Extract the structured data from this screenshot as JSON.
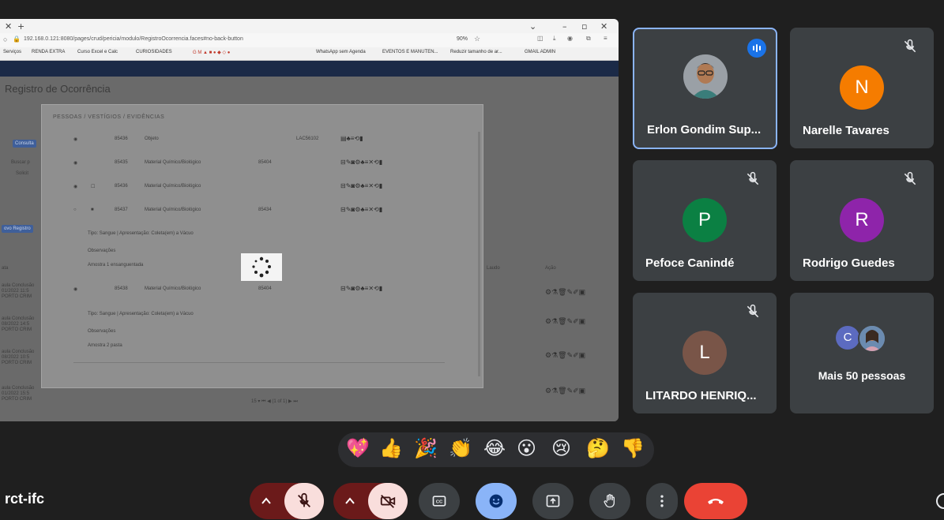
{
  "meeting": {
    "code": "rct-ifc"
  },
  "browser": {
    "url": "192.168.0.121:8080/pages/crud/pericia/modulo/RegistroOcorrencia.faces#no-back-button",
    "zoom": "90%",
    "bookmarks": [
      "Serviços",
      "RENDA EXTRA",
      "Curso Excel e Calc",
      "CURIOSIDADES",
      "WhatsApp sem Agenda",
      "EVENTOS E MANUTEN...",
      "Reduzir tamanho de ar...",
      "GMAIL ADMIN"
    ]
  },
  "app": {
    "page_title": "Registro de Ocorrência",
    "modal_title": "PESSOAS / VESTÍGIOS / EVIDÊNCIAS",
    "rows": [
      {
        "code": "85436",
        "desc": "Objeto",
        "ref": "",
        "lac": "LAC56102"
      },
      {
        "code": "85435",
        "desc": "Material Químico/Biológico",
        "ref": "85404",
        "lac": ""
      },
      {
        "code": "85436",
        "desc": "Material Químico/Biológico",
        "ref": "",
        "lac": ""
      },
      {
        "code": "85437",
        "desc": "Material Químico/Biológico",
        "ref": "85434",
        "lac": ""
      },
      {
        "code": "85438",
        "desc": "Material Químico/Biológico",
        "ref": "85404",
        "lac": ""
      }
    ],
    "notes": [
      {
        "tipo": "Tipo: Sangue | Apresentação: Coleta(em) a Vácuo",
        "obs_label": "Observações",
        "obs": "Amostra 1 ensanguentada"
      },
      {
        "tipo": "Tipo: Sangue | Apresentação: Coleta(em) a Vácuo",
        "obs_label": "Observações",
        "obs": "Amostra 2 pasta"
      }
    ],
    "pager": "15 ▾   ⏮ ◀   (1 of 1)   ▶ ⏭",
    "col_laudo": "Laudo",
    "col_acao": "Ação"
  },
  "participants": [
    {
      "name": "Erlon Gondim Sup...",
      "initial": "",
      "color": "#5f6368",
      "muted": false,
      "speaking": true
    },
    {
      "name": "Narelle Tavares",
      "initial": "N",
      "color": "#f57c00",
      "muted": true
    },
    {
      "name": "Pefoce Canindé",
      "initial": "P",
      "color": "#0b8043",
      "muted": true
    },
    {
      "name": "Rodrigo Guedes",
      "initial": "R",
      "color": "#8e24aa",
      "muted": true
    },
    {
      "name": "LITARDO HENRIQ...",
      "initial": "L",
      "color": "#795548",
      "muted": true
    },
    {
      "name": "Mais 50 pessoas",
      "initial": "C",
      "color": "#5c6bc0",
      "muted": false
    }
  ],
  "reactions": [
    "💖",
    "👍",
    "🎉",
    "👏",
    "😂",
    "😮",
    "😢",
    "🤔",
    "👎"
  ],
  "colors": {
    "end_call": "#ea4335",
    "active_blue": "#8ab4f8",
    "mic_off_bg": "#f9dedc",
    "tile_bg": "#3c4043"
  }
}
